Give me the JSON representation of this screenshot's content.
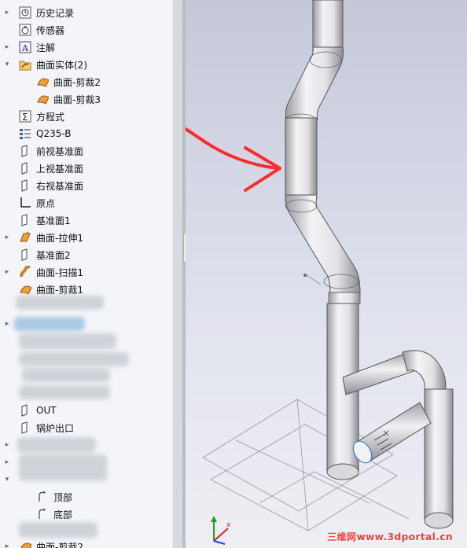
{
  "tree": {
    "items": [
      {
        "label": "历史记录",
        "icon": "history-icon"
      },
      {
        "label": "传感器",
        "icon": "sensor-icon"
      },
      {
        "label": "注解",
        "icon": "annotation-icon"
      },
      {
        "label": "曲面实体(2)",
        "icon": "surface-bodies-folder-icon"
      },
      {
        "label": "曲面-剪裁2",
        "icon": "surface-trim-icon"
      },
      {
        "label": "曲面-剪裁3",
        "icon": "surface-trim-icon"
      },
      {
        "label": "方程式",
        "icon": "equations-icon"
      },
      {
        "label": "Q235-B",
        "icon": "material-icon"
      },
      {
        "label": "前视基准面",
        "icon": "plane-icon"
      },
      {
        "label": "上视基准面",
        "icon": "plane-icon"
      },
      {
        "label": "右视基准面",
        "icon": "plane-icon"
      },
      {
        "label": "原点",
        "icon": "origin-icon"
      },
      {
        "label": "基准面1",
        "icon": "plane-icon"
      },
      {
        "label": "曲面-拉伸1",
        "icon": "surface-extrude-icon"
      },
      {
        "label": "基准面2",
        "icon": "plane-icon"
      },
      {
        "label": "曲面-扫描1",
        "icon": "surface-sweep-icon"
      },
      {
        "label": "曲面-剪裁1",
        "icon": "surface-trim-icon"
      },
      {
        "label": "OUT",
        "icon": "plane-icon"
      },
      {
        "label": "锅炉出口",
        "icon": "plane-icon"
      },
      {
        "label": "顶部",
        "icon": "sketch-icon"
      },
      {
        "label": "底部",
        "icon": "sketch-icon"
      },
      {
        "label": "曲面-剪裁2",
        "icon": "surface-trim-icon"
      }
    ]
  },
  "viewport": {
    "watermark": "三维网www.3dportal.cn"
  },
  "colors": {
    "tree_bg": "#f3f5f8",
    "annotation_arrow": "#ff2a2a",
    "pipe_fill": "#e8e8ea",
    "axis_x": "#e02020",
    "axis_y": "#20a020",
    "axis_z": "#2040e0"
  }
}
